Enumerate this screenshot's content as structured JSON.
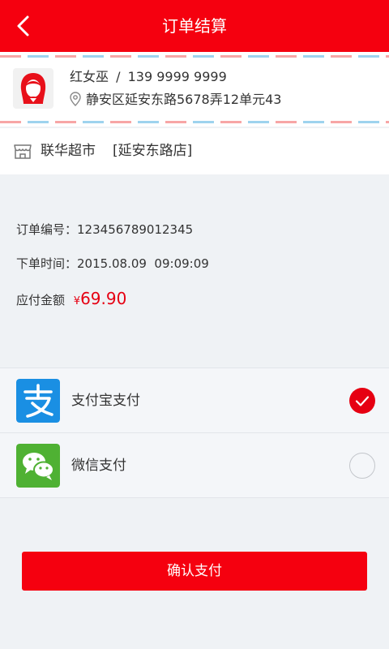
{
  "header": {
    "title": "订单结算"
  },
  "recipient": {
    "name": "红女巫",
    "separator": "/",
    "phone": "139 9999 9999",
    "address": "静安区延安东路5678弄12单元43"
  },
  "store": {
    "name": "联华超市",
    "branch": "[延安东路店]"
  },
  "order": {
    "number_label": "订单编号：",
    "number": "123456789012345",
    "time_label": "下单时间：",
    "time": "2015.08.09  09:09:09",
    "amount_label": "应付金额",
    "currency": "¥",
    "amount": "69.90"
  },
  "payment": {
    "methods": [
      {
        "label": "支付宝支付",
        "icon": "alipay-icon",
        "selected": true
      },
      {
        "label": "微信支付",
        "icon": "wechat-icon",
        "selected": false
      }
    ]
  },
  "actions": {
    "confirm_label": "确认支付"
  },
  "colors": {
    "brand": "#f5000f",
    "price": "#e60012",
    "alipay": "#1a8fe3",
    "wechat": "#4fb133"
  }
}
